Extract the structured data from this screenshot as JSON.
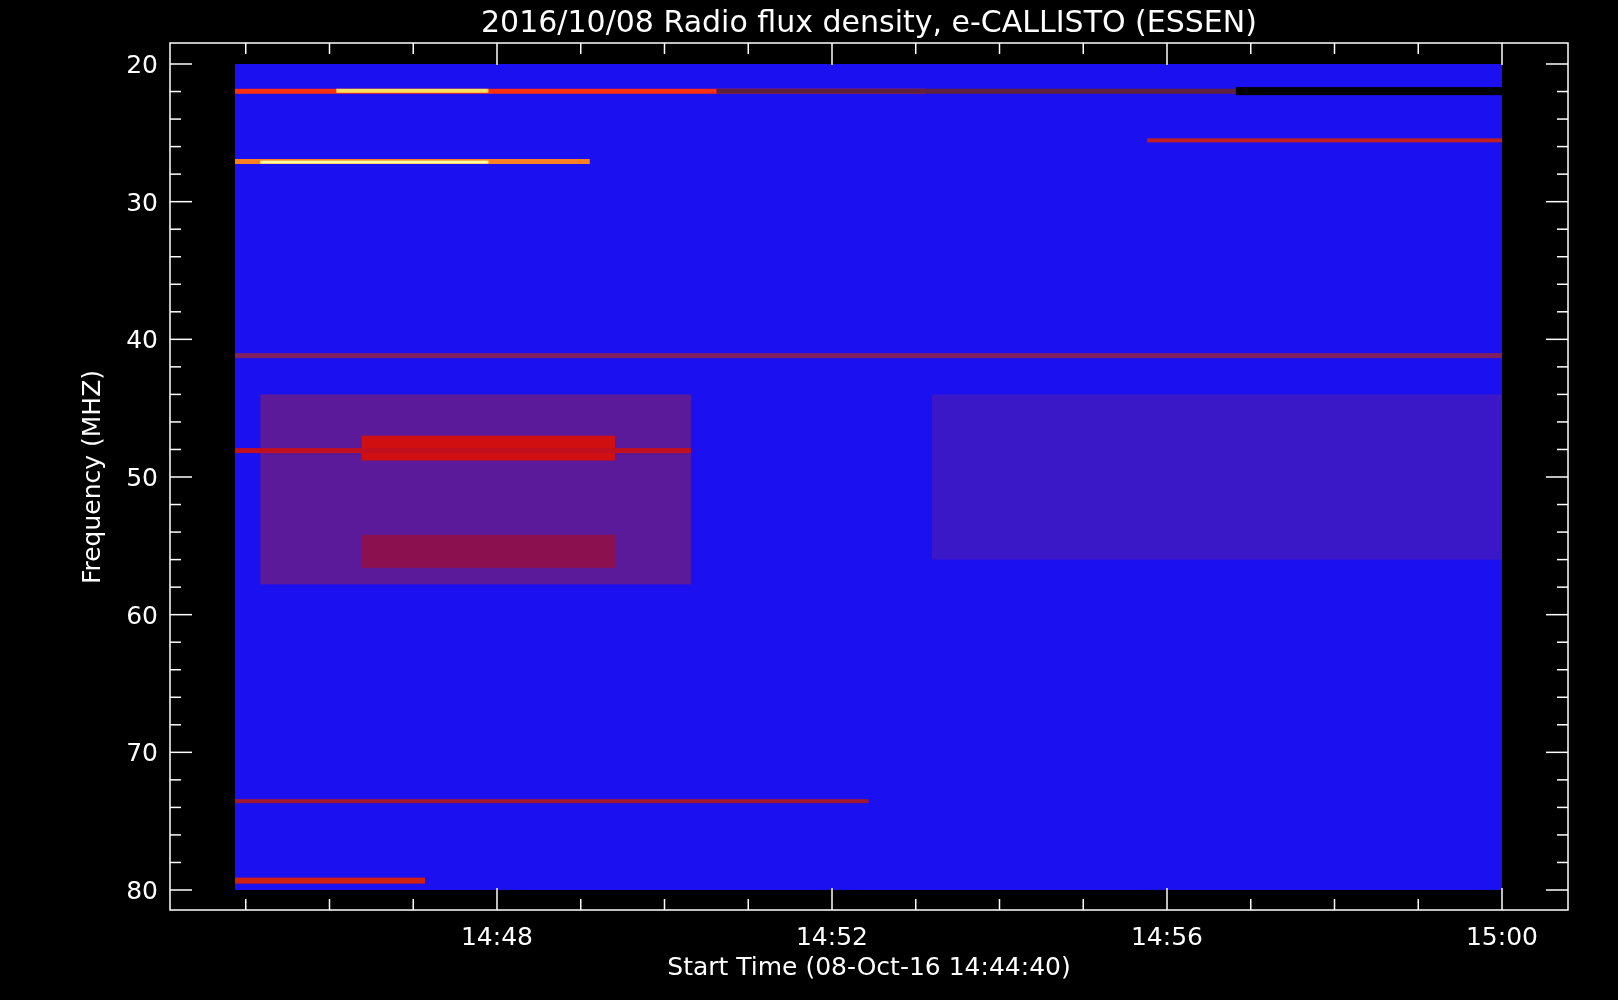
{
  "title": "2016/10/08  Radio flux density, e-CALLISTO (ESSEN)",
  "y_axis": {
    "label": "Frequency (MHZ)",
    "ticks": [
      "20",
      "30",
      "40",
      "50",
      "60",
      "70",
      "80"
    ]
  },
  "x_axis": {
    "label": "Start Time (08-Oct-16 14:44:40)",
    "ticks": [
      "14:48",
      "14:52",
      "14:56",
      "15:00"
    ]
  }
}
